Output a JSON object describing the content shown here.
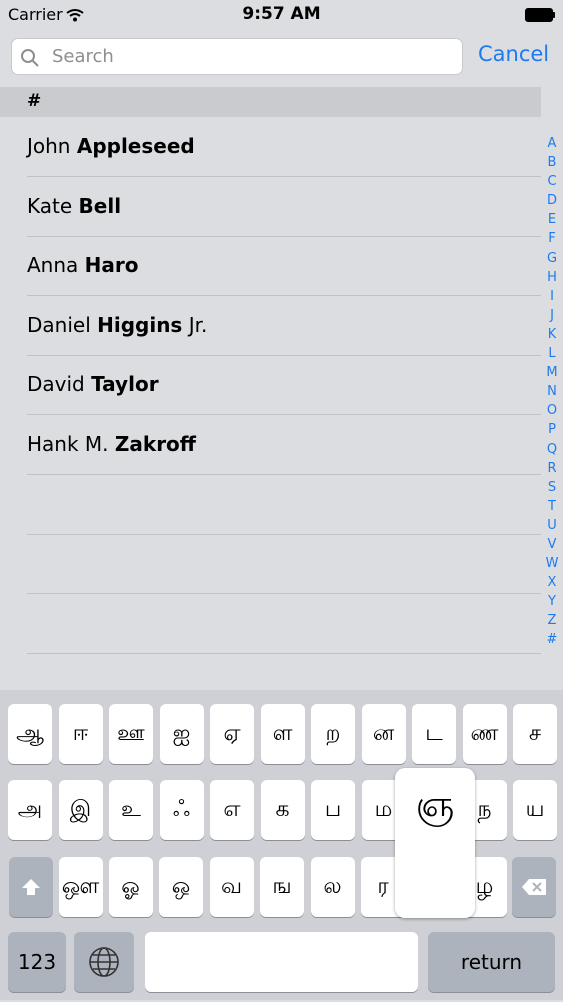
{
  "status_bar": {
    "carrier": "Carrier",
    "time": "9:57 AM"
  },
  "search": {
    "placeholder": "Search",
    "cancel_label": "Cancel"
  },
  "section": {
    "header": "#"
  },
  "contacts": [
    {
      "first": "John ",
      "last": "Appleseed",
      "suffix": ""
    },
    {
      "first": "Kate ",
      "last": "Bell",
      "suffix": ""
    },
    {
      "first": "Anna ",
      "last": "Haro",
      "suffix": ""
    },
    {
      "first": "Daniel ",
      "last": "Higgins",
      "suffix": " Jr."
    },
    {
      "first": "David ",
      "last": "Taylor",
      "suffix": ""
    },
    {
      "first": "Hank M. ",
      "last": "Zakroff",
      "suffix": ""
    }
  ],
  "index_letters": [
    "A",
    "B",
    "C",
    "D",
    "E",
    "F",
    "G",
    "H",
    "I",
    "J",
    "K",
    "L",
    "M",
    "N",
    "O",
    "P",
    "Q",
    "R",
    "S",
    "T",
    "U",
    "V",
    "W",
    "X",
    "Y",
    "Z",
    "#"
  ],
  "keyboard": {
    "row1": [
      "ஆ",
      "ஈ",
      "ஊ",
      "ஐ",
      "ஏ",
      "ள",
      "ற",
      "ன",
      "ட",
      "ண",
      "ச"
    ],
    "row2": [
      "அ",
      "இ",
      "உ",
      "ஃ",
      "எ",
      "க",
      "ப",
      "ம",
      "",
      "ந",
      "ய"
    ],
    "row3": [
      "ஔ",
      "ஓ",
      "ஒ",
      "வ",
      "ங",
      "ல",
      "ர",
      "",
      "ழ"
    ],
    "popup_char": "ஞ",
    "numbers_label": "123",
    "return_label": "return"
  },
  "colors": {
    "accent": "#1d7af2",
    "background": "#dcdde0",
    "keyboard": "#ced0d5"
  }
}
